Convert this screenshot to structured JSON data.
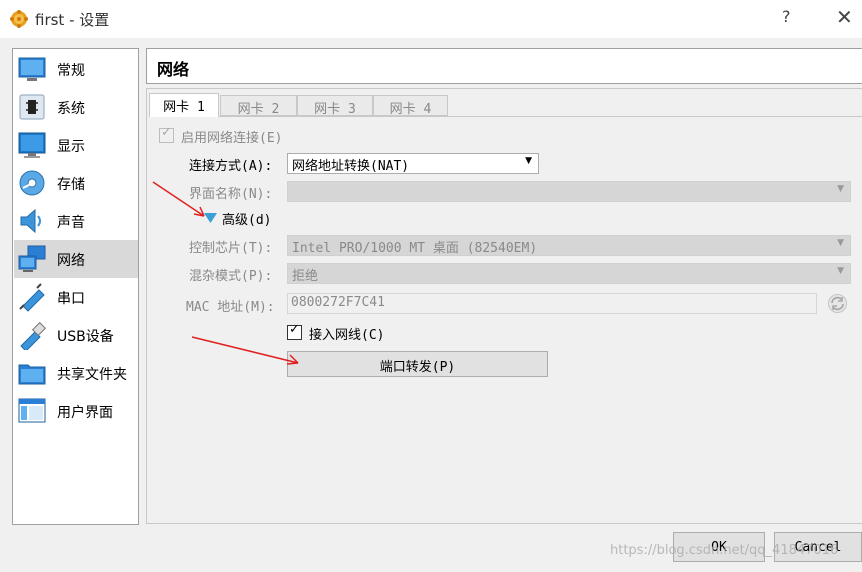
{
  "window": {
    "title": "first - 设置",
    "help_glyph": "?",
    "close_glyph": "✕"
  },
  "sidebar": {
    "items": [
      {
        "label": "常规",
        "icon": "general-icon"
      },
      {
        "label": "系统",
        "icon": "system-icon"
      },
      {
        "label": "显示",
        "icon": "display-icon"
      },
      {
        "label": "存储",
        "icon": "storage-icon"
      },
      {
        "label": "声音",
        "icon": "audio-icon"
      },
      {
        "label": "网络",
        "icon": "network-icon",
        "selected": true
      },
      {
        "label": "串口",
        "icon": "serial-port-icon"
      },
      {
        "label": "USB设备",
        "icon": "usb-icon"
      },
      {
        "label": "共享文件夹",
        "icon": "shared-folder-icon"
      },
      {
        "label": "用户界面",
        "icon": "user-interface-icon"
      }
    ]
  },
  "page": {
    "title": "网络"
  },
  "tabs": [
    "网卡 1",
    "网卡 2",
    "网卡 3",
    "网卡 4"
  ],
  "adapter": {
    "enable_label": "启用网络连接(E)",
    "enable_checked": true,
    "attached_label": "连接方式(A):",
    "attached_value": "网络地址转换(NAT)",
    "name_label": "界面名称(N):",
    "name_value": "",
    "advanced_label": "高级(d)",
    "adapter_type_label": "控制芯片(T):",
    "adapter_type_value": "Intel PRO/1000 MT 桌面 (82540EM)",
    "promisc_label": "混杂模式(P):",
    "promisc_value": "拒绝",
    "mac_label": "MAC 地址(M):",
    "mac_value": "0800272F7C41",
    "cable_label": "接入网线(C)",
    "cable_checked": true,
    "port_forward_label": "端口转发(P)"
  },
  "footer": {
    "ok_label": "OK",
    "cancel_label": "Cancel",
    "watermark": "https://blog.csdn.net/qq_41847016"
  },
  "colors": {
    "selected_bg": "#d9d9d9",
    "annotation_arrow": "#e02020",
    "expand_triangle": "#3aa0d8"
  }
}
